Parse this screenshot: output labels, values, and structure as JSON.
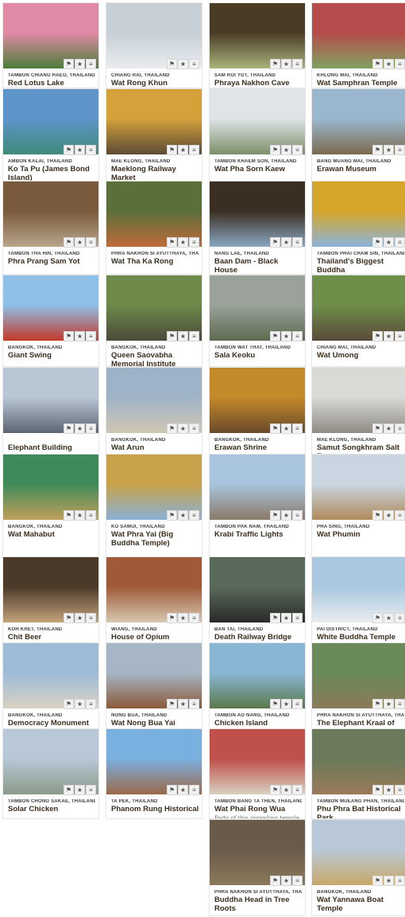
{
  "places": [
    {
      "location": "TAMBON CHIANG HAEO, THAILAND",
      "title": "Red Lotus Lake",
      "description": "",
      "colors": [
        "#e08aa5",
        "#4c7d3a"
      ]
    },
    {
      "location": "CHIANG RAI, THAILAND",
      "title": "Wat Rong Khun",
      "description": "",
      "colors": [
        "#c7d0d6",
        "#e9ecef"
      ]
    },
    {
      "location": "SAM ROI YOT, THAILAND",
      "title": "Phraya Nakhon Cave",
      "description": "",
      "colors": [
        "#4a3b26",
        "#a8b37a"
      ]
    },
    {
      "location": "KHLONG MAI, THAILAND",
      "title": "Wat Samphran Temple",
      "description": "",
      "colors": [
        "#b84b4b",
        "#7fa35f"
      ]
    },
    {
      "location": "AMBON KALAI, THAILAND",
      "title": "Ko Ta Pu (James Bond Island)",
      "description": "",
      "colors": [
        "#5e94c9",
        "#3f8a7a"
      ]
    },
    {
      "location": "MAE KLONG, THAILAND",
      "title": "Maeklong Railway Market",
      "description": "",
      "colors": [
        "#d4a13a",
        "#5d4b35"
      ]
    },
    {
      "location": "TAMBON KHAEM SON, THAILAND",
      "title": "Wat Pha Sorn Kaew",
      "description": "",
      "colors": [
        "#dfe4e6",
        "#7b8f6a"
      ]
    },
    {
      "location": "BANG MUANG MAI, THAILAND",
      "title": "Erawan Museum",
      "description": "",
      "colors": [
        "#9bb7cf",
        "#7a6a4e"
      ]
    },
    {
      "location": "TAMBON THA HIN, THAILAND",
      "title": "Phra Prang Sam Yot",
      "description": "",
      "colors": [
        "#7a5a3c",
        "#b8a58a"
      ]
    },
    {
      "location": "PHRA NAKHON SI AYUTTHAYA, THAILAND",
      "title": "Wat Tha Ka Rong",
      "description": "",
      "colors": [
        "#5a6f3a",
        "#c06a3a"
      ]
    },
    {
      "location": "NANG LAE, THAILAND",
      "title": "Baan Dam - Black House",
      "description": "",
      "colors": [
        "#3b2e22",
        "#8aa7c2"
      ]
    },
    {
      "location": "TAMBON PHAI CHAM SIN, THAILAND",
      "title": "Thailand's Biggest Buddha",
      "description": "",
      "colors": [
        "#d6a62a",
        "#8cb3d9"
      ]
    },
    {
      "location": "BANGKOK, THAILAND",
      "title": "Giant Swing",
      "description": "",
      "colors": [
        "#8ec0e8",
        "#c23a2a"
      ]
    },
    {
      "location": "BANGKOK, THAILAND",
      "title": "Queen Saovabha Memorial Institute",
      "description": "",
      "colors": [
        "#6d8a4a",
        "#4a4a3a"
      ]
    },
    {
      "location": "TAMBON WAT THAT, THAILAND",
      "title": "Sala Keoku",
      "description": "",
      "colors": [
        "#9aa29a",
        "#5e6a4f"
      ]
    },
    {
      "location": "CHIANG MAI, THAILAND",
      "title": "Wat Umong",
      "description": "",
      "colors": [
        "#6d8f4a",
        "#5a4a3a"
      ]
    },
    {
      "location": "",
      "title": "Elephant Building",
      "description": "",
      "colors": [
        "#b9c6d4",
        "#5c6672"
      ]
    },
    {
      "location": "BANGKOK, THAILAND",
      "title": "Wat Arun",
      "description": "",
      "colors": [
        "#9fb3c8",
        "#cfc6b4"
      ]
    },
    {
      "location": "BANGKOK, THAILAND",
      "title": "Erawan Shrine",
      "description": "",
      "colors": [
        "#c38a2a",
        "#6a4a2a"
      ]
    },
    {
      "location": "MAE KLONG, THAILAND",
      "title": "Samut Songkhram Salt Farms",
      "description": "",
      "colors": [
        "#d9d9d6",
        "#8e8b84"
      ]
    },
    {
      "location": "BANGKOK, THAILAND",
      "title": "Wat Mahabut",
      "description": "",
      "colors": [
        "#3f8a5a",
        "#c0a05a"
      ]
    },
    {
      "location": "KO SAMUI, THAILAND",
      "title": "Wat Phra Yai (Big Buddha Temple)",
      "description": "",
      "colors": [
        "#c8a24a",
        "#8ab0d6"
      ]
    },
    {
      "location": "TAMBON PAK NAM, THAILAND",
      "title": "Krabi Traffic Lights",
      "description": "",
      "colors": [
        "#a9c4de",
        "#8a7a6a"
      ]
    },
    {
      "location": "PHA SING, THAILAND",
      "title": "Wat Phumin",
      "description": "",
      "colors": [
        "#c9d6e2",
        "#b08a5a"
      ]
    },
    {
      "location": "KOH KRET, THAILAND",
      "title": "Chit Beer",
      "description": "",
      "colors": [
        "#4a3a2a",
        "#c4a27a"
      ]
    },
    {
      "location": "WIANG, THAILAND",
      "title": "House of Opium",
      "description": "",
      "colors": [
        "#a05a3a",
        "#d6c8b0"
      ]
    },
    {
      "location": "BAN TAI, THAILAND",
      "title": "Death Railway Bridge",
      "description": "",
      "colors": [
        "#5a6a5a",
        "#2a2a2a"
      ]
    },
    {
      "location": "PAI DISTRICT, THAILAND",
      "title": "White Buddha Temple",
      "description": "",
      "colors": [
        "#aac8e0",
        "#e8ecef"
      ]
    },
    {
      "location": "BANGKOK, THAILAND",
      "title": "Democracy Monument",
      "description": "",
      "colors": [
        "#9dbbd7",
        "#d9d2c2"
      ]
    },
    {
      "location": "NONG BUA, THAILAND",
      "title": "Wat Nong Bua Yai",
      "description": "",
      "colors": [
        "#a7b6c6",
        "#8a5a3a"
      ]
    },
    {
      "location": "TAMBON AO NANG, THAILAND",
      "title": "Chicken Island",
      "description": "",
      "colors": [
        "#8ab6d6",
        "#5a7a4a"
      ]
    },
    {
      "location": "PHRA NAKHON SI AYUTTHAYA, THAILAND",
      "title": "The Elephant Kraal of",
      "description": "",
      "colors": [
        "#6a8a5a",
        "#8a7a5a"
      ]
    },
    {
      "location": "TAMBON CHONG SAKAE, THAILAND",
      "title": "Solar Chicken",
      "description": "",
      "colors": [
        "#b8c8d6",
        "#8a9a8a"
      ]
    },
    {
      "location": "TA PEK, THAILAND",
      "title": "Phanom Rung Historical",
      "description": "",
      "colors": [
        "#7ab0e0",
        "#9a6a4a"
      ]
    },
    {
      "location": "TAMBON BANG TA THEN, THAILAND",
      "title": "Wat Phai Rong Wua",
      "description": "Parts of this sprawling temple",
      "colors": [
        "#c0504a",
        "#d8d0c0"
      ]
    },
    {
      "location": "TAMBON MUEANG PHAN, THAILAND",
      "title": "Phu Phra Bat Historical Park",
      "description": "",
      "colors": [
        "#6a7a5a",
        "#9a7a5a"
      ]
    },
    {
      "location": "PHRA NAKHON SI AYUTTHAYA, THAILAND",
      "title": "Buddha Head in Tree Roots",
      "description": "",
      "colors": [
        "#6a5a4a",
        "#8a7a5a"
      ]
    },
    {
      "location": "BANGKOK, THAILAND",
      "title": "Wat Yannawa Boat Temple",
      "description": "",
      "colors": [
        "#b8c8d8",
        "#c8a86a"
      ]
    }
  ]
}
